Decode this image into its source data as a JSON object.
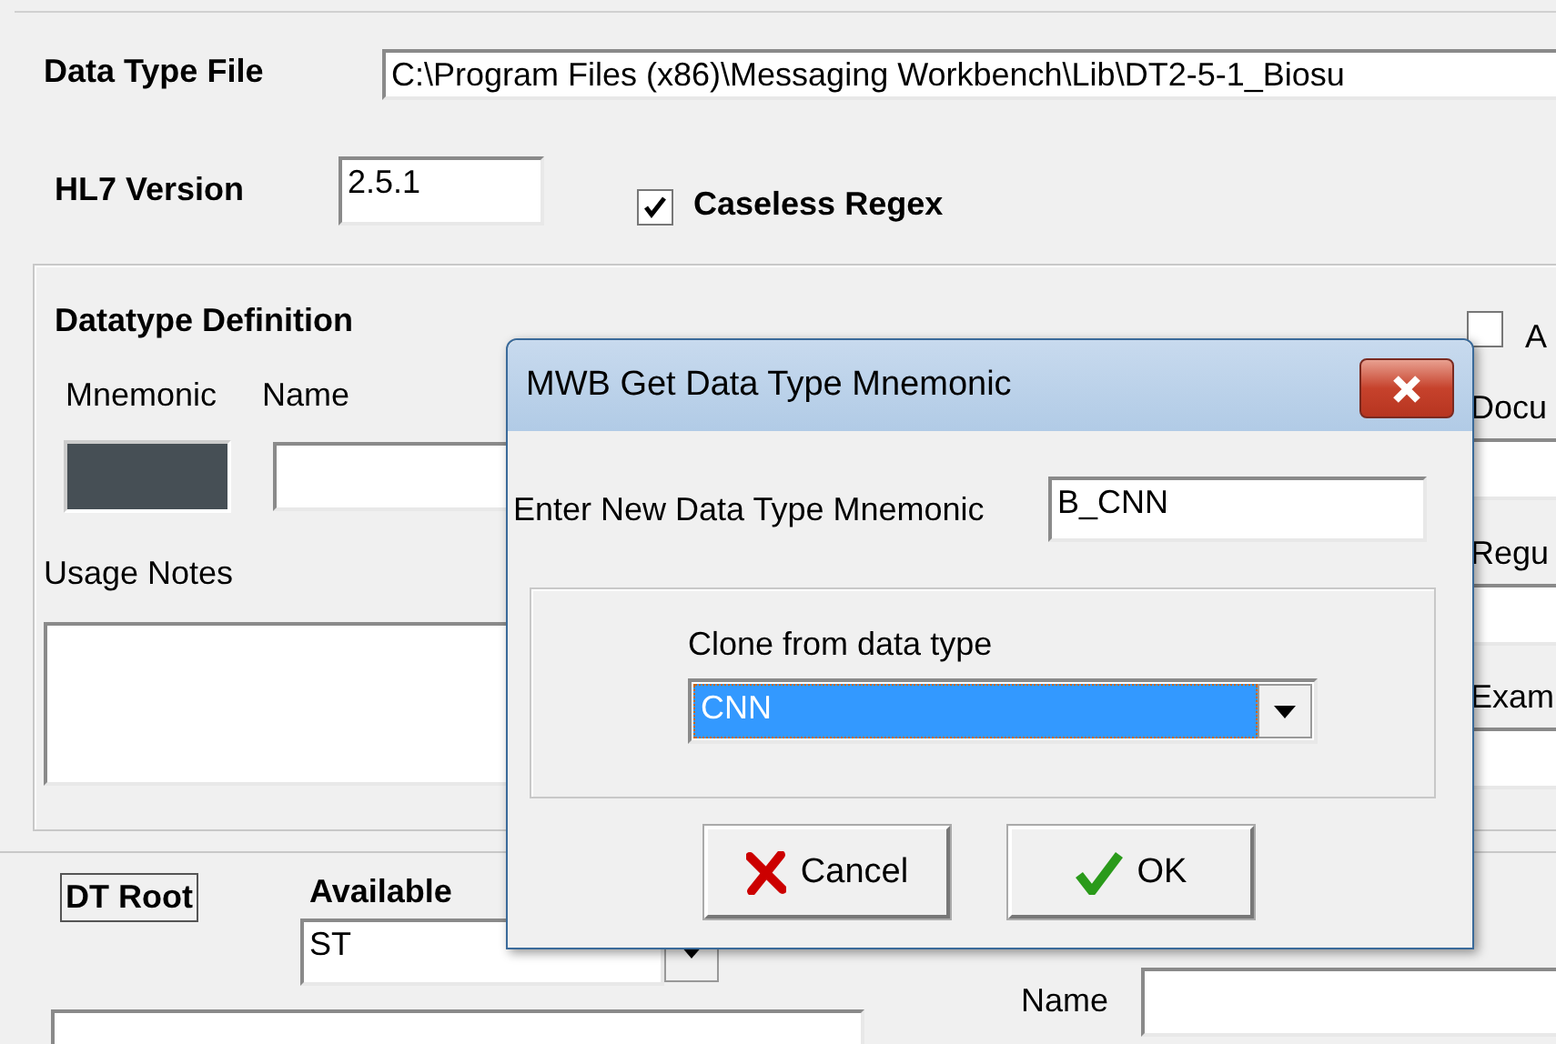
{
  "form": {
    "data_type_file": {
      "label": "Data Type File",
      "value": "C:\\Program Files (x86)\\Messaging Workbench\\Lib\\DT2-5-1_Biosu"
    },
    "hl7_version": {
      "label": "HL7 Version",
      "value": "2.5.1"
    },
    "caseless_regex": {
      "label": "Caseless Regex",
      "checked": true
    },
    "definition": {
      "title": "Datatype Definition",
      "mnemonic_label": "Mnemonic",
      "name_label": "Name",
      "usage_notes_label": "Usage Notes",
      "right_checkbox": {
        "label": "A",
        "checked": false
      },
      "right_labels": [
        "Docu",
        "Regu",
        "Exam"
      ]
    },
    "bottom": {
      "dt_root": "DT Root",
      "available_label": "Available",
      "available_value": "ST",
      "name_label": "Name"
    }
  },
  "dialog": {
    "title": "MWB Get Data Type Mnemonic",
    "mnemonic_label": "Enter New Data Type Mnemonic",
    "mnemonic_value": "B_CNN",
    "clone_label": "Clone from data type",
    "clone_value": "CNN",
    "buttons": [
      {
        "kind": "cancel",
        "label": "Cancel"
      },
      {
        "kind": "ok",
        "label": "OK"
      }
    ]
  }
}
